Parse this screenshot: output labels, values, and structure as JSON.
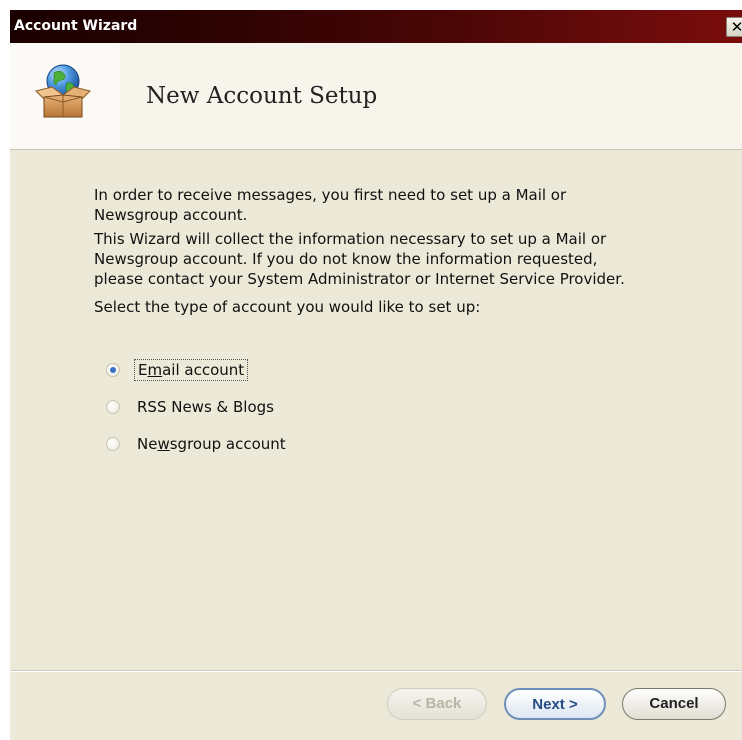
{
  "window": {
    "title": "Account Wizard",
    "close_glyph": "✕"
  },
  "banner": {
    "title": "New Account Setup",
    "icon": "globe-in-box-icon"
  },
  "content": {
    "intro_line1": "In order to receive messages, you first need to set up a Mail or",
    "intro_line2": "Newsgroup account.",
    "wizard_line1": "This Wizard will collect the information necessary to set up a Mail or",
    "wizard_line2": "Newsgroup account. If you do not know the information requested,",
    "wizard_line3": "please contact your System Administrator or Internet Service Provider.",
    "select_prompt": "Select the type of account you would like to set up:"
  },
  "account_types": {
    "selected": "Email account",
    "email": {
      "prefix": "E",
      "accel": "m",
      "suffix": "ail account"
    },
    "rss": {
      "label": "RSS News & Blogs"
    },
    "newsgroup": {
      "prefix": "Ne",
      "accel": "w",
      "suffix": "sgroup account"
    }
  },
  "buttons": {
    "back": "< Back",
    "next": "Next >",
    "cancel": "Cancel"
  },
  "colors": {
    "titlebar_start": "#1a0000",
    "titlebar_end": "#7a0c0c",
    "dialog_bg": "#ece9d8",
    "accent": "#3b6fc6"
  }
}
